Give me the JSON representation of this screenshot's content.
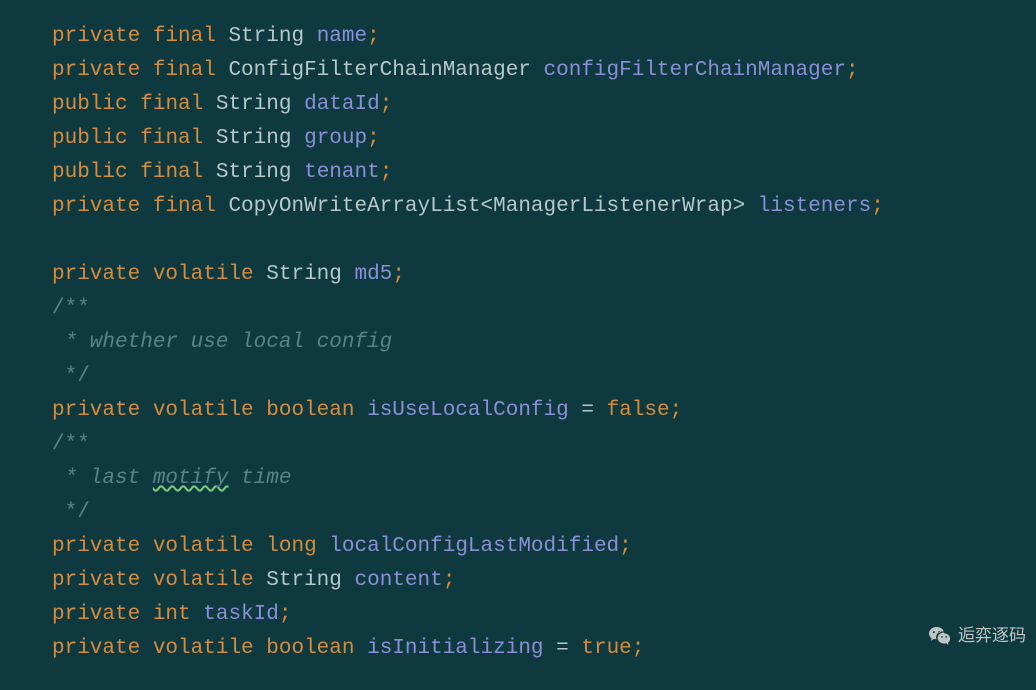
{
  "code": {
    "lines": [
      {
        "type": "blank"
      },
      {
        "type": "decl",
        "access": "private",
        "mod": "final",
        "vartype": "String",
        "name": "name"
      },
      {
        "type": "decl",
        "access": "private",
        "mod": "final",
        "vartype": "ConfigFilterChainManager",
        "name": "configFilterChainManager"
      },
      {
        "type": "decl",
        "access": "public",
        "mod": "final",
        "vartype": "String",
        "name": "dataId"
      },
      {
        "type": "decl",
        "access": "public",
        "mod": "final",
        "vartype": "String",
        "name": "group"
      },
      {
        "type": "decl",
        "access": "public",
        "mod": "final",
        "vartype": "String",
        "name": "tenant"
      },
      {
        "type": "decl-generic",
        "access": "private",
        "mod": "final",
        "vartype": "CopyOnWriteArrayList",
        "generic": "ManagerListenerWrap",
        "name": "listeners"
      },
      {
        "type": "blank"
      },
      {
        "type": "decl",
        "access": "private",
        "mod": "volatile",
        "vartype": "String",
        "name": "md5"
      },
      {
        "type": "comment-open",
        "text": "/**"
      },
      {
        "type": "comment-line",
        "text": " * whether use local config"
      },
      {
        "type": "comment-close",
        "text": " */"
      },
      {
        "type": "decl-init",
        "access": "private",
        "mod": "volatile",
        "vartype": "boolean",
        "name": "isUseLocalConfig",
        "value": "false"
      },
      {
        "type": "comment-open",
        "text": "/**"
      },
      {
        "type": "comment-line-typo",
        "prefix": " * last ",
        "typo": "motify",
        "suffix": " time"
      },
      {
        "type": "comment-close",
        "text": " */"
      },
      {
        "type": "decl",
        "access": "private",
        "mod": "volatile",
        "vartype": "long",
        "name": "localConfigLastModified"
      },
      {
        "type": "decl",
        "access": "private",
        "mod": "volatile",
        "vartype": "String",
        "name": "content"
      },
      {
        "type": "decl-simple",
        "access": "private",
        "vartype": "int",
        "name": "taskId"
      },
      {
        "type": "decl-init",
        "access": "private",
        "mod": "volatile",
        "vartype": "boolean",
        "name": "isInitializing",
        "value": "true"
      }
    ]
  },
  "watermark": {
    "text": "逅弈逐码",
    "icon": "wechat-icon"
  },
  "colors": {
    "background": "#0e3a3f",
    "keyword": "#d68c3e",
    "type": "#b6c8c9",
    "field": "#8a8fd6",
    "comment": "#5a8286"
  }
}
